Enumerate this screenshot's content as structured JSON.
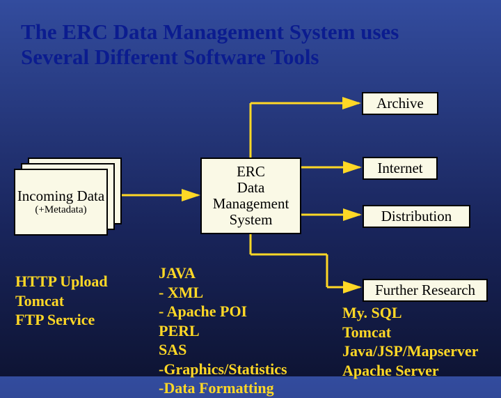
{
  "title": "The ERC Data Management System uses Several Different Software Tools",
  "incoming": {
    "label": "Incoming Data",
    "meta": "(+Metadata)"
  },
  "erc": {
    "l1": "ERC",
    "l2": "Data",
    "l3": "Management",
    "l4": "System"
  },
  "archive": "Archive",
  "internet": "Internet",
  "distribution": "Distribution",
  "further": "Further Research",
  "left_list": {
    "a": "HTTP Upload",
    "b": "Tomcat",
    "c": "FTP Service"
  },
  "mid_list": {
    "a": "JAVA",
    "a1": "- XML",
    "a2": "- Apache POI",
    "b": "PERL",
    "c": "SAS",
    "d": "-Graphics/Statistics",
    "e": "-Data Formatting"
  },
  "right_list": {
    "a": "My. SQL",
    "b": "Tomcat",
    "c": "Java/JSP/Mapserver",
    "d": "Apache Server"
  }
}
